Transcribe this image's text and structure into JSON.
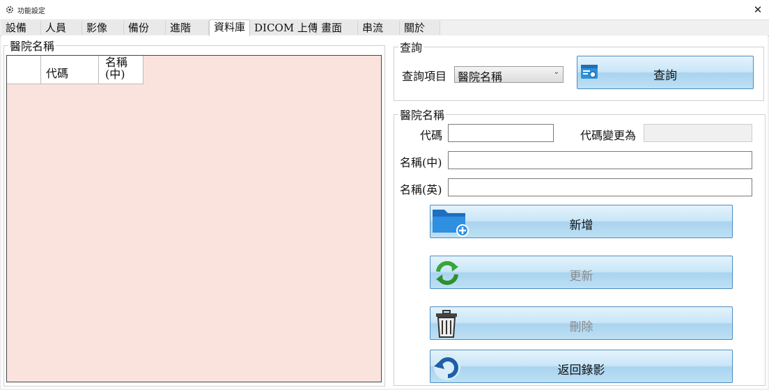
{
  "window": {
    "title": "功能設定",
    "app_icon": "gear-icon",
    "close_glyph": "✕"
  },
  "tabs": [
    {
      "label": "設備"
    },
    {
      "label": "人員"
    },
    {
      "label": "影像"
    },
    {
      "label": "備份"
    },
    {
      "label": "進階"
    },
    {
      "label": "資料庫",
      "active": true
    },
    {
      "label": "DICOM 上傳"
    },
    {
      "label": "畫面"
    },
    {
      "label": "串流"
    },
    {
      "label": "關於"
    }
  ],
  "left_group": {
    "legend": "醫院名稱",
    "grid_background": "#fbe3dd",
    "columns": [
      "",
      "代碼",
      "名稱\n(中)"
    ],
    "rows": []
  },
  "query": {
    "legend": "查詢",
    "field_label": "查詢項目",
    "select_value": "醫院名稱",
    "button_label": "查詢",
    "button_icon": "card-search-icon"
  },
  "form": {
    "legend": "醫院名稱",
    "code_label": "代碼",
    "code_value": "",
    "code_change_label": "代碼變更為",
    "code_change_value": "",
    "name_zh_label": "名稱(中)",
    "name_zh_value": "",
    "name_en_label": "名稱(英)",
    "name_en_value": ""
  },
  "actions": {
    "add_label": "新增",
    "add_icon": "folder-add-icon",
    "update_label": "更新",
    "update_icon": "refresh-icon",
    "delete_label": "刪除",
    "delete_icon": "trash-icon",
    "back_label": "返回錄影",
    "back_icon": "undo-arrow-icon"
  },
  "colors": {
    "button_border": "#4d8bc0",
    "button_fill": "#c9e6f7",
    "disabled_text": "#8a8a8a"
  }
}
